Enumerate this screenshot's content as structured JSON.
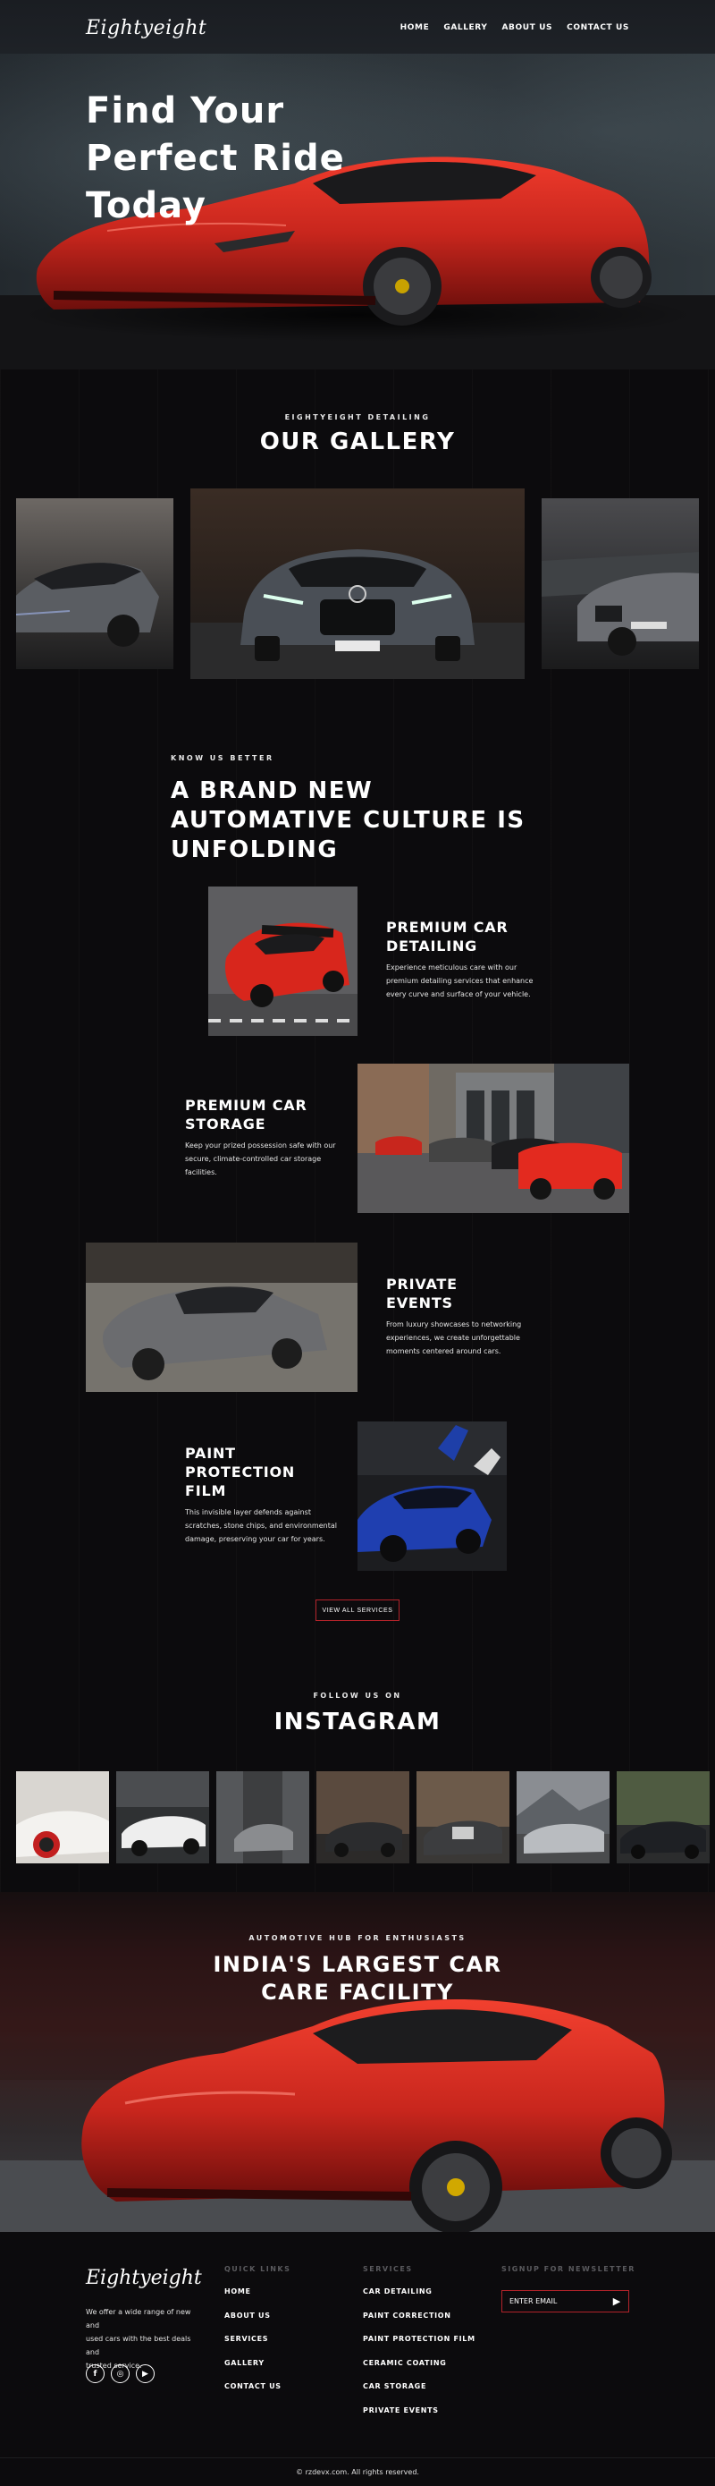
{
  "brand": {
    "logo": "Eightyeight"
  },
  "nav": {
    "items": [
      "HOME",
      "GALLERY",
      "ABOUT US",
      "CONTACT US"
    ]
  },
  "hero": {
    "title_lines": [
      "Find Your",
      "Perfect Ride",
      "Today"
    ]
  },
  "gallery": {
    "eyebrow": "EIGHTYEIGHT DETAILING",
    "title": "OUR GALLERY"
  },
  "about": {
    "eyebrow": "KNOW US BETTER",
    "title_lines": [
      "A BRAND NEW",
      "AUTOMATIVE CULTURE IS",
      "UNFOLDING"
    ]
  },
  "services": [
    {
      "title_lines": [
        "PREMIUM CAR",
        "DETAILING"
      ],
      "desc_lines": [
        "Experience meticulous care with our",
        "premium detailing services that enhance",
        "every curve and surface of your vehicle."
      ]
    },
    {
      "title_lines": [
        "PREMIUM CAR",
        "STORAGE"
      ],
      "desc_lines": [
        "Keep your prized possession safe with our",
        "secure, climate-controlled car storage",
        "facilities."
      ]
    },
    {
      "title_lines": [
        "PRIVATE",
        "EVENTS"
      ],
      "desc_lines": [
        "From luxury showcases to networking",
        "experiences, we create unforgettable",
        "moments centered around cars."
      ]
    },
    {
      "title_lines": [
        "PAINT",
        "PROTECTION",
        "FILM"
      ],
      "desc_lines": [
        "This invisible layer defends against",
        "scratches, stone chips, and environmental",
        "damage, preserving your car for years."
      ]
    }
  ],
  "view_all_label": "VIEW ALL SERVICES",
  "instagram": {
    "eyebrow": "FOLLOW US ON",
    "title": "INSTAGRAM"
  },
  "banner": {
    "eyebrow": "AUTOMOTIVE HUB FOR ENTHUSIASTS",
    "title_lines": [
      "INDIA'S LARGEST CAR",
      "CARE FACILITY"
    ]
  },
  "footer": {
    "logo": "Eightyeight",
    "about_lines": [
      "We offer a wide range of new and",
      "used cars with the best deals and",
      "trusted service."
    ],
    "socials": [
      "f",
      "◎",
      "▶"
    ],
    "quick_links": {
      "title": "QUICK LINKS",
      "items": [
        "HOME",
        "ABOUT US",
        "SERVICES",
        "GALLERY",
        "CONTACT US"
      ]
    },
    "services": {
      "title": "SERVICES",
      "items": [
        "CAR DETAILING",
        "PAINT CORRECTION",
        "PAINT PROTECTION FILM",
        "CERAMIC COATING",
        "CAR STORAGE",
        "PRIVATE EVENTS"
      ]
    },
    "newsletter": {
      "title": "SIGNUP FOR NEWSLETTER",
      "placeholder": "ENTER EMAIL"
    },
    "copyright": "© rzdevx.com. All rights reserved."
  },
  "colors": {
    "accent": "#b3232a",
    "background": "#0c0b0d",
    "car_red": "#c8261d"
  },
  "icons": {
    "send": "play-arrow-icon",
    "facebook": "facebook-icon",
    "instagram": "instagram-icon",
    "youtube": "youtube-icon"
  }
}
